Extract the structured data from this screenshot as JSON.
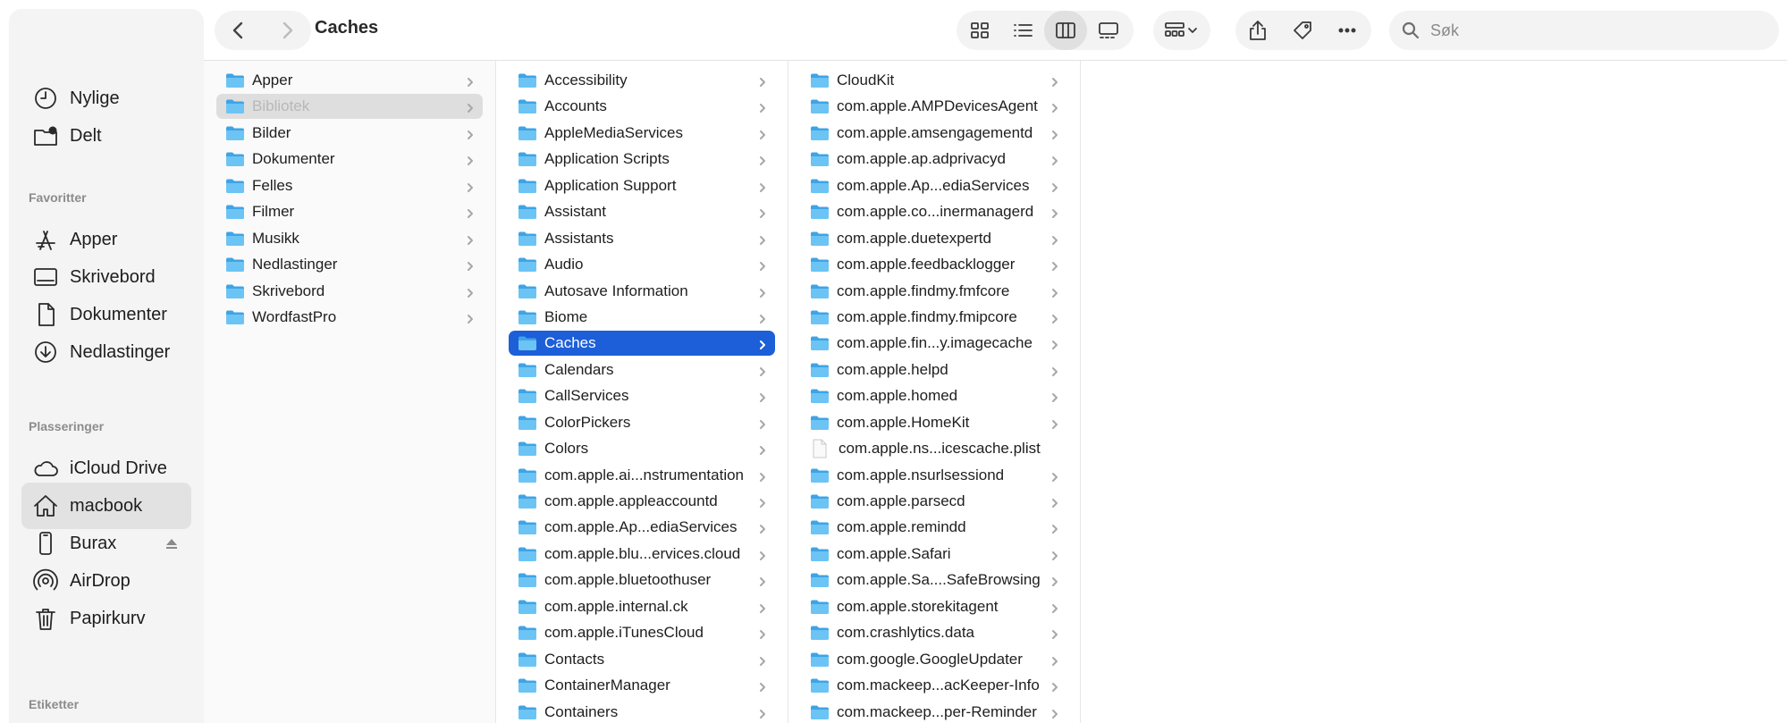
{
  "window": {
    "title": "Caches"
  },
  "toolbar": {
    "search_placeholder": "Søk",
    "view_icons": [
      "grid-view-icon",
      "list-view-icon",
      "column-view-icon",
      "gallery-view-icon"
    ],
    "active_view": "column-view-icon"
  },
  "sidebar": {
    "top_items": [
      {
        "label": "Nylige",
        "icon": "clock-icon"
      },
      {
        "label": "Delt",
        "icon": "shared-folder-icon"
      }
    ],
    "favorites_header": "Favoritter",
    "favorites": [
      {
        "label": "Apper",
        "icon": "apps-icon"
      },
      {
        "label": "Skrivebord",
        "icon": "desktop-icon"
      },
      {
        "label": "Dokumenter",
        "icon": "document-icon"
      },
      {
        "label": "Nedlastinger",
        "icon": "download-icon"
      }
    ],
    "locations_header": "Plasseringer",
    "locations": [
      {
        "label": "iCloud Drive",
        "icon": "cloud-icon"
      },
      {
        "label": "macbook",
        "icon": "home-icon",
        "selected": true
      },
      {
        "label": "Burax",
        "icon": "phone-icon",
        "ejectable": true
      },
      {
        "label": "AirDrop",
        "icon": "airdrop-icon"
      },
      {
        "label": "Papirkurv",
        "icon": "trash-icon"
      }
    ],
    "tags_header": "Etiketter"
  },
  "columns": [
    {
      "items": [
        "Apper",
        "Bibliotek",
        "Bilder",
        "Dokumenter",
        "Felles",
        "Filmer",
        "Musikk",
        "Nedlastinger",
        "Skrivebord",
        "WordfastPro"
      ],
      "selected_index": 1
    },
    {
      "items": [
        "Accessibility",
        "Accounts",
        "AppleMediaServices",
        "Application Scripts",
        "Application Support",
        "Assistant",
        "Assistants",
        "Audio",
        "Autosave Information",
        "Biome",
        "Caches",
        "Calendars",
        "CallServices",
        "ColorPickers",
        "Colors",
        "com.apple.ai...nstrumentation",
        "com.apple.appleaccountd",
        "com.apple.Ap...ediaServices",
        "com.apple.blu...ervices.cloud",
        "com.apple.bluetoothuser",
        "com.apple.internal.ck",
        "com.apple.iTunesCloud",
        "Contacts",
        "ContainerManager",
        "Containers"
      ],
      "selected_index": 10
    },
    {
      "items": [
        "CloudKit",
        "com.apple.AMPDevicesAgent",
        "com.apple.amsengagementd",
        "com.apple.ap.adprivacyd",
        "com.apple.Ap...ediaServices",
        "com.apple.co...inermanagerd",
        "com.apple.duetexpertd",
        "com.apple.feedbacklogger",
        "com.apple.findmy.fmfcore",
        "com.apple.findmy.fmipcore",
        "com.apple.fin...y.imagecache",
        "com.apple.helpd",
        "com.apple.homed",
        "com.apple.HomeKit",
        "com.apple.ns...icescache.plist",
        "com.apple.nsurlsessiond",
        "com.apple.parsecd",
        "com.apple.remindd",
        "com.apple.Safari",
        "com.apple.Sa....SafeBrowsing",
        "com.apple.storekitagent",
        "com.crashlytics.data",
        "com.google.GoogleUpdater",
        "com.mackeep...acKeeper-Info",
        "com.mackeep...per-Reminder"
      ],
      "file_indices": [
        14
      ],
      "selected_index": -1
    }
  ]
}
